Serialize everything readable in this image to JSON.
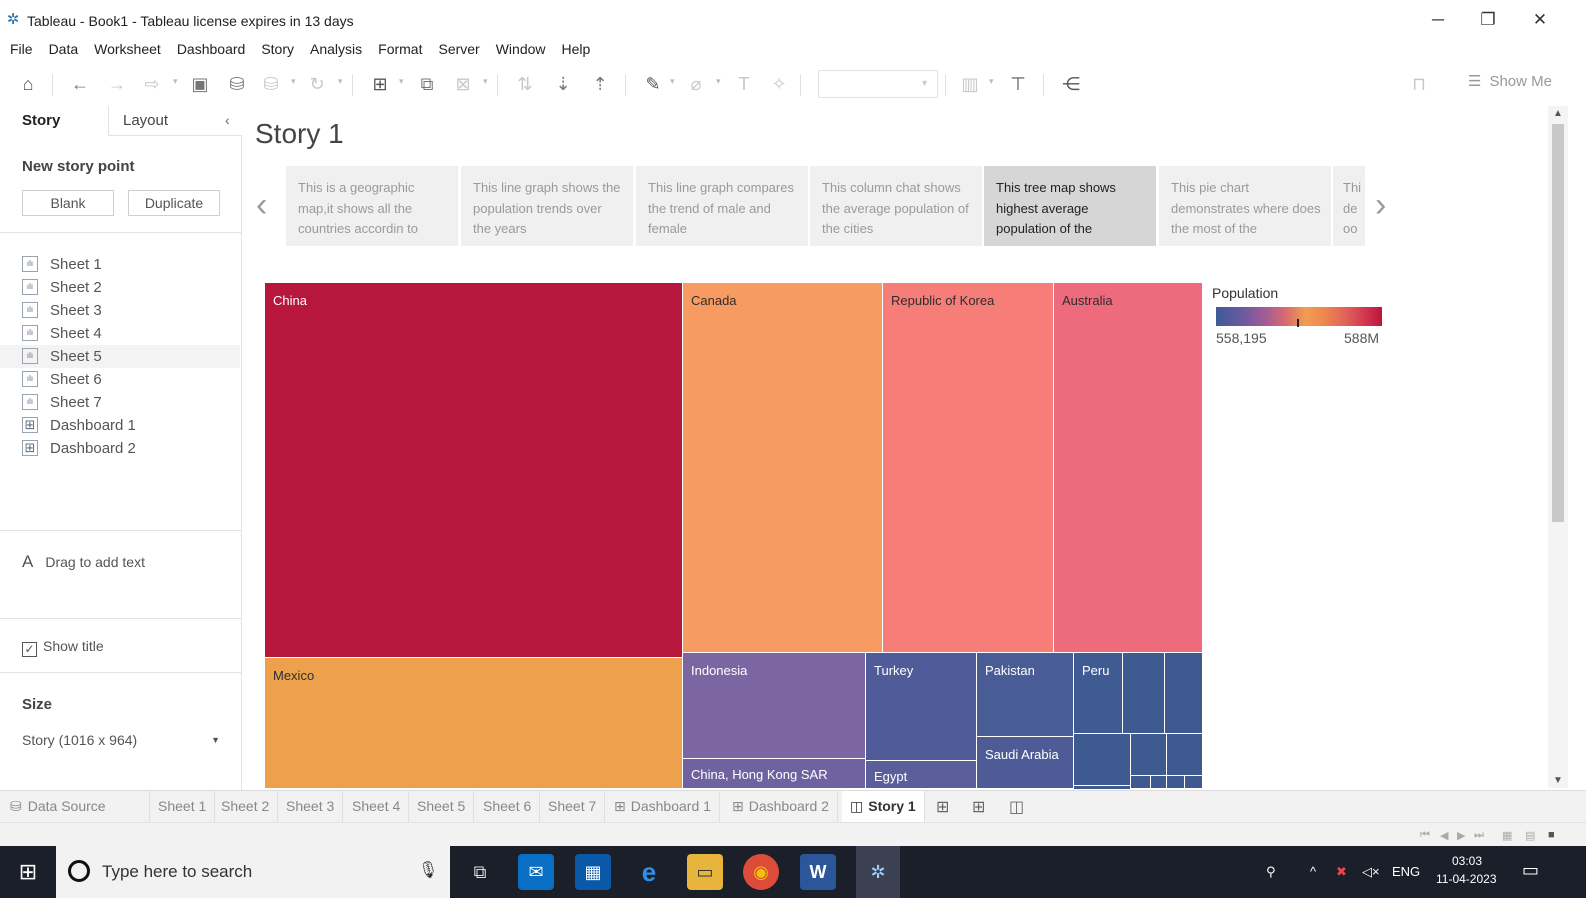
{
  "window": {
    "title": "Tableau - Book1 - Tableau license expires in 13 days",
    "app_icon": "tableau-icon",
    "controls": [
      "minimize-icon",
      "restore-icon",
      "close-icon"
    ]
  },
  "menu": [
    "File",
    "Data",
    "Worksheet",
    "Dashboard",
    "Story",
    "Analysis",
    "Format",
    "Server",
    "Window",
    "Help"
  ],
  "toolbar": {
    "icons": [
      "home-icon",
      "undo-icon",
      "redo-icon",
      "replay-icon",
      "save-icon",
      "new-datasource-icon",
      "pause-updates-icon",
      "refresh-icon",
      "new-worksheet-icon",
      "duplicate-sheet-icon",
      "clear-sheet-icon",
      "swap-axes-icon",
      "sort-ascending-icon",
      "sort-descending-icon",
      "highlight-icon",
      "group-icon",
      "labels-icon",
      "pin-icon",
      "fit-dropdown",
      "chart-dropdown-icon",
      "presentation-icon",
      "share-icon",
      "format-painter-icon"
    ],
    "show_me": "Show Me"
  },
  "left_panel": {
    "tabs": [
      "Story",
      "Layout"
    ],
    "new_story_point": "New story point",
    "buttons": {
      "blank": "Blank",
      "duplicate": "Duplicate"
    },
    "sheets": [
      "Sheet 1",
      "Sheet 2",
      "Sheet 3",
      "Sheet 4",
      "Sheet 5",
      "Sheet 6",
      "Sheet 7"
    ],
    "dashboards": [
      "Dashboard 1",
      "Dashboard 2"
    ],
    "drag_text": "Drag to add text",
    "show_title": "Show title",
    "show_title_checked": true,
    "size_label": "Size",
    "size_value": "Story (1016 x 964)"
  },
  "story": {
    "title": "Story 1",
    "points": [
      {
        "text": "This is a geographic map,it shows all the countries accordin to",
        "active": false
      },
      {
        "text": "This line graph shows the population trends over the years",
        "active": false
      },
      {
        "text": "This line graph compares the trend of male and female",
        "active": false
      },
      {
        "text": "This column chat shows the average population of the cities",
        "active": false
      },
      {
        "text": "This tree map shows highest average population of the",
        "active": true
      },
      {
        "text": "This pie chart demonstrates where does the most of the",
        "active": false
      },
      {
        "text": "Thi de oo",
        "active": false
      }
    ]
  },
  "treemap": {
    "cells": [
      {
        "label": "China",
        "color": "#b8173d"
      },
      {
        "label": "Mexico",
        "color": "#eea14c"
      },
      {
        "label": "Canada",
        "color": "#f89b62"
      },
      {
        "label": "Republic of Korea",
        "color": "#f67d78"
      },
      {
        "label": "Australia",
        "color": "#ee6b7e"
      },
      {
        "label": "Indonesia",
        "color": "#7b66a2"
      },
      {
        "label": "China, Hong Kong SAR",
        "color": "#6e63a0"
      },
      {
        "label": "Turkey",
        "color": "#505c99"
      },
      {
        "label": "Egypt",
        "color": "#5a5e9b"
      },
      {
        "label": "Pakistan",
        "color": "#4a5c96"
      },
      {
        "label": "Saudi Arabia",
        "color": "#4d5c97"
      },
      {
        "label": "Peru",
        "color": "#3f5b92"
      },
      {
        "label": "",
        "color": "#3e5a91"
      }
    ],
    "legend": {
      "title": "Population",
      "min": "558,195",
      "max": "588M"
    }
  },
  "bottom_tabs": {
    "data_source": "Data Source",
    "tabs": [
      "Sheet 1",
      "Sheet 2",
      "Sheet 3",
      "Sheet 4",
      "Sheet 5",
      "Sheet 6",
      "Sheet 7",
      "Dashboard 1",
      "Dashboard 2",
      "Story 1"
    ],
    "active": "Story 1",
    "add_icons": [
      "new-worksheet-icon",
      "new-dashboard-icon",
      "new-story-icon"
    ]
  },
  "taskbar": {
    "search_placeholder": "Type here to search",
    "apps": [
      "task-view-icon",
      "mail-icon",
      "store-icon",
      "edge-icon",
      "file-explorer-icon",
      "chrome-icon",
      "word-icon",
      "tableau-icon"
    ],
    "tray": {
      "language": "ENG",
      "time": "03:03",
      "date": "11-04-2023"
    }
  }
}
